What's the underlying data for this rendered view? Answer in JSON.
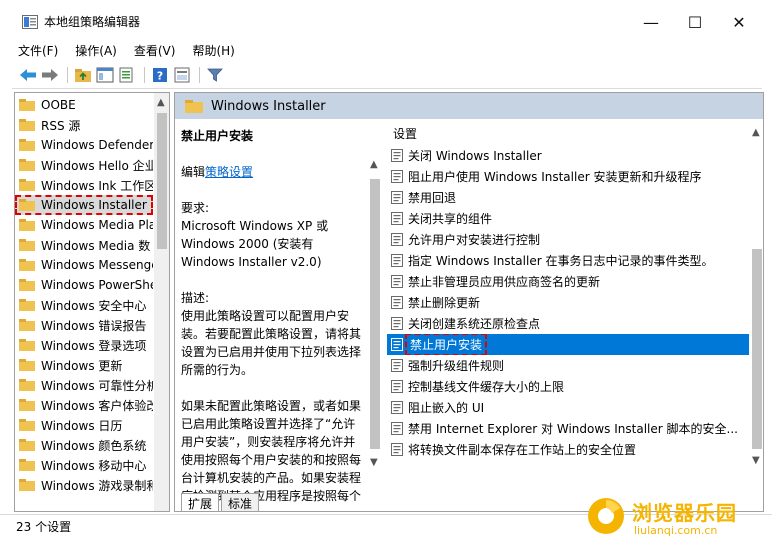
{
  "window": {
    "title": "本地组策略编辑器",
    "minimize": "—",
    "maximize": "☐",
    "close": "✕"
  },
  "menu": [
    "文件(F)",
    "操作(A)",
    "查看(V)",
    "帮助(H)"
  ],
  "toolbar": {
    "icons": [
      "back-icon",
      "forward-icon",
      "up-folder-icon",
      "show-hide-tree-icon",
      "export-list-icon",
      "help-icon",
      "properties-icon",
      "filter-icon"
    ]
  },
  "tree": {
    "items": [
      {
        "label": "OOBE"
      },
      {
        "label": "RSS 源"
      },
      {
        "label": "Windows Defender"
      },
      {
        "label": "Windows Hello 企业"
      },
      {
        "label": "Windows Ink 工作区"
      },
      {
        "label": "Windows Installer",
        "selected": true
      },
      {
        "label": "Windows Media Pla"
      },
      {
        "label": "Windows Media 数"
      },
      {
        "label": "Windows Messenge"
      },
      {
        "label": "Windows PowerShe"
      },
      {
        "label": "Windows 安全中心"
      },
      {
        "label": "Windows 错误报告"
      },
      {
        "label": "Windows 登录选项"
      },
      {
        "label": "Windows 更新"
      },
      {
        "label": "Windows 可靠性分析"
      },
      {
        "label": "Windows 客户体验改"
      },
      {
        "label": "Windows 日历"
      },
      {
        "label": "Windows 颜色系统"
      },
      {
        "label": "Windows 移动中心"
      },
      {
        "label": "Windows 游戏录制和"
      }
    ]
  },
  "content": {
    "header": "Windows Installer",
    "description": {
      "title": "禁止用户安装",
      "edit_prefix": "编辑",
      "edit_link": "策略设置",
      "requirements_label": "要求:",
      "requirements": "Microsoft Windows XP 或 Windows 2000 (安装有 Windows Installer v2.0)",
      "desc_label": "描述:",
      "desc_text": "使用此策略设置可以配置用户安装。若要配置此策略设置，请将其设置为已启用并使用下拉列表选择所需的行为。",
      "desc_more": "如果未配置此策略设置，或者如果已启用此策略设置并选择了“允许用户安装”，则安装程序将允许并使用按照每个用户安装的和按照每台计算机安装的产品。如果安装程序检测到某个应用程序是按照每个用户"
    },
    "settings_header": "设置",
    "settings": [
      {
        "label": "关闭 Windows Installer"
      },
      {
        "label": "阻止用户使用 Windows Installer 安装更新和升级程序"
      },
      {
        "label": "禁用回退"
      },
      {
        "label": "关闭共享的组件"
      },
      {
        "label": "允许用户对安装进行控制"
      },
      {
        "label": "指定 Windows Installer 在事务日志中记录的事件类型。"
      },
      {
        "label": "禁止非管理员应用供应商签名的更新"
      },
      {
        "label": "禁止删除更新"
      },
      {
        "label": "关闭创建系统还原检查点"
      },
      {
        "label": "禁止用户安装",
        "selected": true
      },
      {
        "label": "强制升级组件规则"
      },
      {
        "label": "控制基线文件缓存大小的上限"
      },
      {
        "label": "阻止嵌入的 UI"
      },
      {
        "label": "禁用 Internet Explorer 对 Windows Installer 脚本的安全..."
      },
      {
        "label": "将转换文件副本保存在工作站上的安全位置"
      }
    ],
    "tabs": [
      "扩展",
      "标准"
    ]
  },
  "status": {
    "text": "23 个设置"
  },
  "watermark": {
    "title": "浏览器乐园",
    "url": "liulanqi.com.cn"
  }
}
